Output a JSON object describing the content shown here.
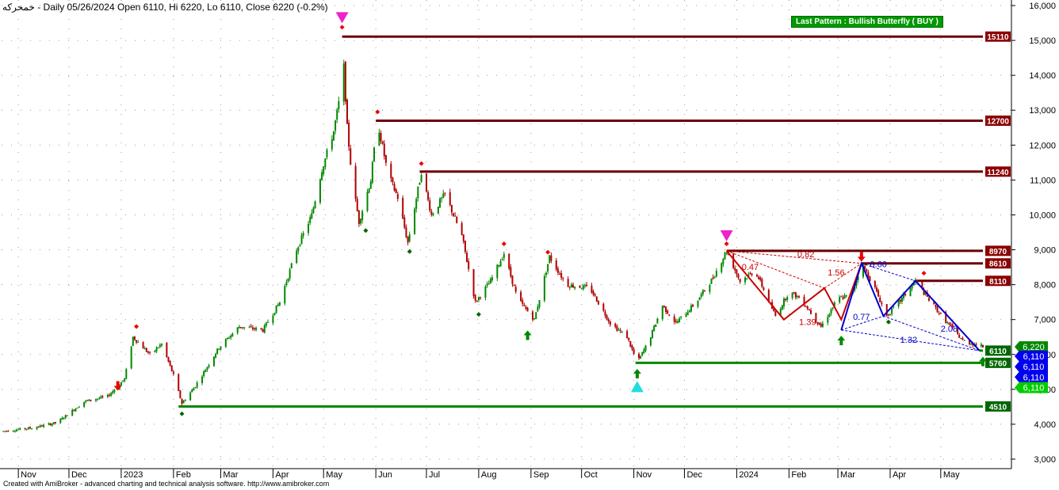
{
  "header": {
    "symbol": "خمحرکه",
    "info": "- Daily 05/26/2024 Open 6110, Hi 6220, Lo 6110, Close 6220 (-0.2%)"
  },
  "footer": {
    "credit": "Created with AmiBroker - advanced charting and technical analysis software. http://www.amibroker.com"
  },
  "pattern_label": "Last Pattern : Bullish Butterfly ( BUY )",
  "colors": {
    "candle_up": "#008800",
    "candle_down": "#b00000",
    "resistance": "#6b0000",
    "support": "#008800",
    "pattern_red": "#cc0000",
    "pattern_blue": "#0000cc",
    "signal_magenta": "#ee22cc",
    "signal_cyan": "#22dddd"
  },
  "chart_data": {
    "type": "candlestick",
    "title": "",
    "ylim": [
      2700,
      16100
    ],
    "y_ticks": [
      {
        "v": 3000,
        "label": "3,000"
      },
      {
        "v": 4000,
        "label": "4,000"
      },
      {
        "v": 5000,
        "label": "5,000"
      },
      {
        "v": 6000,
        "label": "6,000"
      },
      {
        "v": 7000,
        "label": "7,000"
      },
      {
        "v": 8000,
        "label": "8,000"
      },
      {
        "v": 9000,
        "label": "9,000"
      },
      {
        "v": 10000,
        "label": "10,000"
      },
      {
        "v": 11000,
        "label": "11,000"
      },
      {
        "v": 12000,
        "label": "12,000"
      },
      {
        "v": 13000,
        "label": "13,000"
      },
      {
        "v": 14000,
        "label": "14,000"
      },
      {
        "v": 15000,
        "label": "15,000"
      },
      {
        "v": 16000,
        "label": "16,000"
      }
    ],
    "x_labels": [
      "Nov",
      "Dec",
      "2023",
      "Feb",
      "Mar",
      "Apr",
      "May",
      "Jun",
      "Jul",
      "Aug",
      "Sep",
      "Oct",
      "Nov",
      "Dec",
      "2024",
      "Feb",
      "Mar",
      "Apr",
      "May"
    ],
    "price_path": [
      {
        "d": "2022-10-23",
        "p": 3800
      },
      {
        "d": "2022-11-10",
        "p": 3900
      },
      {
        "d": "2022-11-24",
        "p": 4050
      },
      {
        "d": "2022-12-10",
        "p": 4650
      },
      {
        "d": "2022-12-24",
        "p": 4800
      },
      {
        "d": "2023-01-03",
        "p": 5300
      },
      {
        "d": "2023-01-08",
        "p": 6500
      },
      {
        "d": "2023-01-18",
        "p": 6000
      },
      {
        "d": "2023-01-25",
        "p": 6300
      },
      {
        "d": "2023-02-01",
        "p": 5400
      },
      {
        "d": "2023-02-06",
        "p": 4600
      },
      {
        "d": "2023-02-14",
        "p": 5100
      },
      {
        "d": "2023-02-28",
        "p": 6200
      },
      {
        "d": "2023-03-12",
        "p": 6800
      },
      {
        "d": "2023-03-26",
        "p": 6700
      },
      {
        "d": "2023-04-05",
        "p": 7500
      },
      {
        "d": "2023-04-15",
        "p": 9000
      },
      {
        "d": "2023-04-24",
        "p": 10000
      },
      {
        "d": "2023-04-30",
        "p": 11300
      },
      {
        "d": "2023-05-07",
        "p": 12400
      },
      {
        "d": "2023-05-10",
        "p": 13200
      },
      {
        "d": "2023-05-12",
        "p": 15110
      },
      {
        "d": "2023-05-15",
        "p": 12500
      },
      {
        "d": "2023-05-18",
        "p": 11000
      },
      {
        "d": "2023-05-22",
        "p": 9800
      },
      {
        "d": "2023-05-29",
        "p": 11000
      },
      {
        "d": "2023-06-02",
        "p": 12700
      },
      {
        "d": "2023-06-08",
        "p": 11200
      },
      {
        "d": "2023-06-14",
        "p": 10500
      },
      {
        "d": "2023-06-20",
        "p": 9200
      },
      {
        "d": "2023-06-28",
        "p": 11240
      },
      {
        "d": "2023-07-04",
        "p": 10000
      },
      {
        "d": "2023-07-12",
        "p": 10600
      },
      {
        "d": "2023-07-22",
        "p": 9400
      },
      {
        "d": "2023-07-30",
        "p": 7500
      },
      {
        "d": "2023-08-08",
        "p": 8100
      },
      {
        "d": "2023-08-16",
        "p": 8900
      },
      {
        "d": "2023-08-24",
        "p": 7600
      },
      {
        "d": "2023-09-03",
        "p": 7000
      },
      {
        "d": "2023-09-12",
        "p": 8800
      },
      {
        "d": "2023-09-22",
        "p": 8000
      },
      {
        "d": "2023-10-06",
        "p": 7900
      },
      {
        "d": "2023-10-18",
        "p": 6900
      },
      {
        "d": "2023-10-28",
        "p": 6500
      },
      {
        "d": "2023-11-03",
        "p": 5760
      },
      {
        "d": "2023-11-10",
        "p": 6400
      },
      {
        "d": "2023-11-18",
        "p": 7400
      },
      {
        "d": "2023-11-26",
        "p": 6900
      },
      {
        "d": "2023-12-08",
        "p": 7500
      },
      {
        "d": "2023-12-18",
        "p": 8200
      },
      {
        "d": "2023-12-26",
        "p": 8970
      },
      {
        "d": "2024-01-03",
        "p": 8100
      },
      {
        "d": "2024-01-12",
        "p": 8400
      },
      {
        "d": "2024-01-24",
        "p": 7100
      },
      {
        "d": "2024-02-01",
        "p": 7800
      },
      {
        "d": "2024-02-08",
        "p": 7600
      },
      {
        "d": "2024-02-20",
        "p": 6800
      },
      {
        "d": "2024-03-01",
        "p": 7600
      },
      {
        "d": "2024-03-09",
        "p": 7700
      },
      {
        "d": "2024-03-15",
        "p": 8610
      },
      {
        "d": "2024-03-22",
        "p": 8000
      },
      {
        "d": "2024-03-30",
        "p": 7100
      },
      {
        "d": "2024-04-08",
        "p": 7600
      },
      {
        "d": "2024-04-16",
        "p": 8110
      },
      {
        "d": "2024-04-25",
        "p": 7500
      },
      {
        "d": "2024-05-05",
        "p": 6900
      },
      {
        "d": "2024-05-14",
        "p": 6400
      },
      {
        "d": "2024-05-26",
        "p": 6220
      }
    ],
    "last_bar": {
      "d": "2024-05-26",
      "o": 6110,
      "h": 6220,
      "l": 6110,
      "c": 6220
    },
    "resistance_levels": [
      {
        "value": 15110,
        "label": "15110",
        "from": "2023-05-12"
      },
      {
        "value": 12700,
        "label": "12700",
        "from": "2023-06-01"
      },
      {
        "value": 11240,
        "label": "11240",
        "from": "2023-06-27"
      },
      {
        "value": 8970,
        "label": "8970",
        "from": "2023-12-26"
      },
      {
        "value": 8610,
        "label": "8610",
        "from": "2024-03-15"
      },
      {
        "value": 8110,
        "label": "8110",
        "from": "2024-04-16"
      }
    ],
    "support_levels": [
      {
        "value": 6110,
        "label": "6110",
        "from": "2024-05-24",
        "to_axis": false
      },
      {
        "value": 5760,
        "label": "5760",
        "from": "2023-11-02",
        "to_axis": true
      },
      {
        "value": 4510,
        "label": "4510",
        "from": "2023-02-04",
        "to_axis": true
      }
    ],
    "price_badges": [
      {
        "label": "6,220",
        "value": 6220,
        "color": "#008800"
      },
      {
        "label": "6,110",
        "value": 5950,
        "color": "#0000ee"
      },
      {
        "label": "6,110",
        "value": 5650,
        "color": "#0000ee"
      },
      {
        "label": "6,110",
        "value": 5350,
        "color": "#0000ee"
      },
      {
        "label": "6,110",
        "value": 5050,
        "color": "#00cc00"
      }
    ],
    "pattern_red_path": [
      {
        "d": "2023-12-26",
        "p": 8970
      },
      {
        "d": "2024-01-29",
        "p": 7000
      },
      {
        "d": "2024-02-22",
        "p": 7900
      },
      {
        "d": "2024-03-03",
        "p": 7000
      },
      {
        "d": "2024-03-15",
        "p": 8610
      }
    ],
    "pattern_red_dashed": [
      [
        {
          "d": "2023-12-26",
          "p": 8970
        },
        {
          "d": "2024-02-22",
          "p": 7900
        }
      ],
      [
        {
          "d": "2024-02-22",
          "p": 7900
        },
        {
          "d": "2024-03-15",
          "p": 8610
        }
      ],
      [
        {
          "d": "2023-12-26",
          "p": 8970
        },
        {
          "d": "2024-03-15",
          "p": 8610
        }
      ]
    ],
    "pattern_blue_path": [
      {
        "d": "2024-03-03",
        "p": 6700
      },
      {
        "d": "2024-03-15",
        "p": 8610
      },
      {
        "d": "2024-03-28",
        "p": 7100
      },
      {
        "d": "2024-04-16",
        "p": 8110
      },
      {
        "d": "2024-05-24",
        "p": 6110
      }
    ],
    "pattern_blue_dashed": [
      [
        {
          "d": "2024-03-03",
          "p": 6700
        },
        {
          "d": "2024-03-28",
          "p": 7100
        }
      ],
      [
        {
          "d": "2024-03-28",
          "p": 7100
        },
        {
          "d": "2024-05-24",
          "p": 6110
        }
      ],
      [
        {
          "d": "2024-03-03",
          "p": 6700
        },
        {
          "d": "2024-05-24",
          "p": 6110
        }
      ],
      [
        {
          "d": "2024-03-15",
          "p": 8610
        },
        {
          "d": "2024-04-16",
          "p": 8110
        }
      ]
    ],
    "ratio_labels": [
      {
        "text": "0.47",
        "d": "2024-01-09",
        "p": 8420,
        "color": "#cc0000"
      },
      {
        "text": "0.82",
        "d": "2024-02-11",
        "p": 8780,
        "color": "#cc0000"
      },
      {
        "text": "1.56",
        "d": "2024-02-29",
        "p": 8260,
        "color": "#cc0000"
      },
      {
        "text": "1.39",
        "d": "2024-02-12",
        "p": 6840,
        "color": "#cc0000"
      },
      {
        "text": "0.66",
        "d": "2024-03-25",
        "p": 8500,
        "color": "#0000cc"
      },
      {
        "text": "0.77",
        "d": "2024-03-15",
        "p": 6990,
        "color": "#0000cc"
      },
      {
        "text": "2.08",
        "d": "2024-05-06",
        "p": 6650,
        "color": "#0000cc"
      },
      {
        "text": "1.32",
        "d": "2024-04-12",
        "p": 6330,
        "color": "#0000cc"
      }
    ],
    "signals": [
      {
        "kind": "red-diamond",
        "d": "2023-01-10",
        "p": 6800
      },
      {
        "kind": "green-diamond",
        "d": "2023-02-06",
        "p": 4300
      },
      {
        "kind": "red-arrow-down",
        "d": "2022-12-30",
        "p": 5100
      },
      {
        "kind": "magenta-triangle-down",
        "d": "2023-05-12",
        "p": 15650
      },
      {
        "kind": "red-diamond",
        "d": "2023-05-12",
        "p": 15380
      },
      {
        "kind": "red-diamond",
        "d": "2023-06-02",
        "p": 12950
      },
      {
        "kind": "red-diamond",
        "d": "2023-06-28",
        "p": 11470
      },
      {
        "kind": "green-diamond",
        "d": "2023-05-26",
        "p": 9550
      },
      {
        "kind": "green-diamond",
        "d": "2023-06-21",
        "p": 8950
      },
      {
        "kind": "green-diamond",
        "d": "2023-08-01",
        "p": 7150
      },
      {
        "kind": "red-diamond",
        "d": "2023-08-16",
        "p": 9170
      },
      {
        "kind": "green-arrow-up",
        "d": "2023-08-30",
        "p": 6550
      },
      {
        "kind": "red-diamond",
        "d": "2023-09-11",
        "p": 8930
      },
      {
        "kind": "green-arrow-up",
        "d": "2023-11-03",
        "p": 5450
      },
      {
        "kind": "cyan-triangle-up",
        "d": "2023-11-03",
        "p": 5080
      },
      {
        "kind": "magenta-triangle-down",
        "d": "2023-12-26",
        "p": 9400
      },
      {
        "kind": "red-diamond",
        "d": "2023-12-26",
        "p": 9170
      },
      {
        "kind": "green-arrow-up",
        "d": "2024-03-03",
        "p": 6400
      },
      {
        "kind": "red-arrow-down",
        "d": "2024-03-15",
        "p": 8800
      },
      {
        "kind": "green-diamond",
        "d": "2024-03-31",
        "p": 6930
      },
      {
        "kind": "red-diamond",
        "d": "2024-04-21",
        "p": 8330
      },
      {
        "kind": "green-arrow-up",
        "d": "2024-05-26",
        "p": 5800
      }
    ]
  }
}
